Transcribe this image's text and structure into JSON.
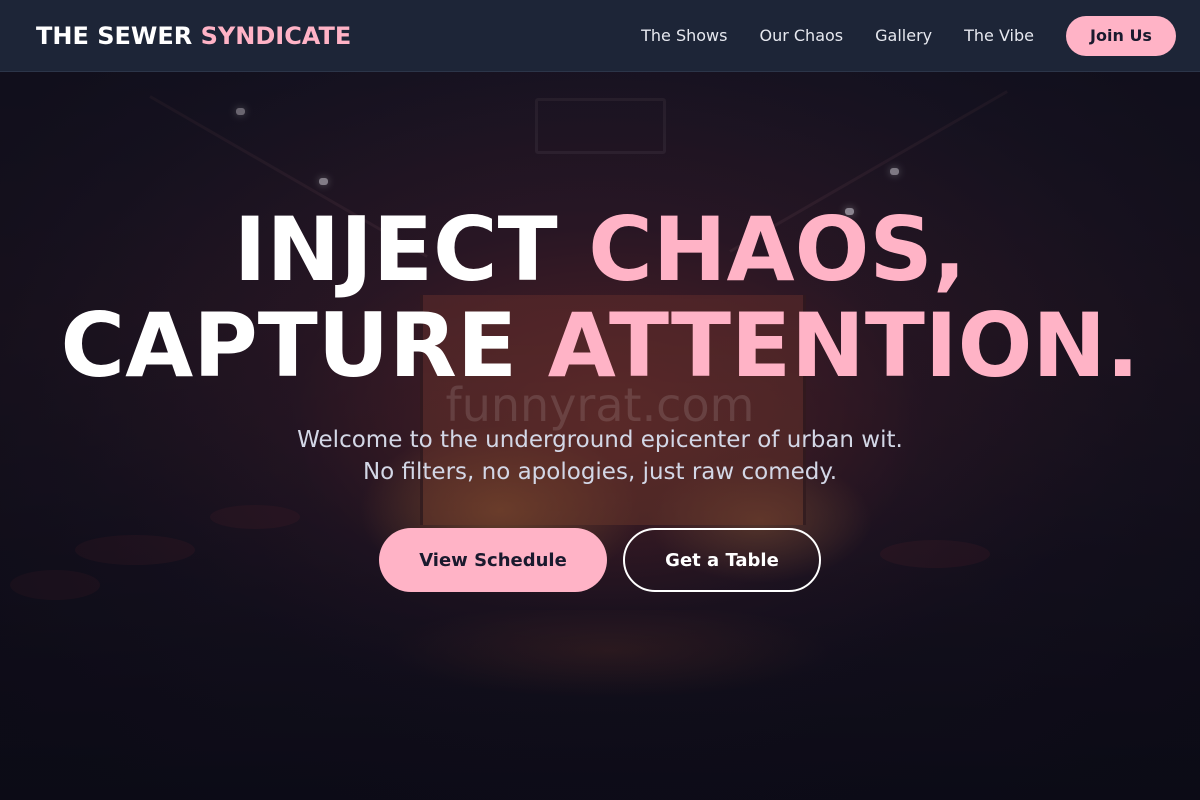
{
  "brand": {
    "name_main": "THE SEWER ",
    "name_accent": "SYNDICATE"
  },
  "nav": {
    "links": [
      {
        "label": "The Shows"
      },
      {
        "label": "Our Chaos"
      },
      {
        "label": "Gallery"
      },
      {
        "label": "The Vibe"
      }
    ],
    "cta_label": "Join Us"
  },
  "hero": {
    "headline_line1_white": "INJECT ",
    "headline_line1_pink": "CHAOS,",
    "headline_line2_white": "CAPTURE ",
    "headline_line2_pink": "ATTENTION.",
    "watermark": "funnyrat.com",
    "subtitle_line1": "Welcome to the underground epicenter of urban wit.",
    "subtitle_line2": "No filters, no apologies, just raw comedy.",
    "primary_button": "View Schedule",
    "secondary_button": "Get a Table"
  },
  "colors": {
    "accent": "#ffb3c6",
    "navbar_bg": "#1d2537",
    "text_dark": "#1a1a2e",
    "text_light": "#ffffff"
  }
}
